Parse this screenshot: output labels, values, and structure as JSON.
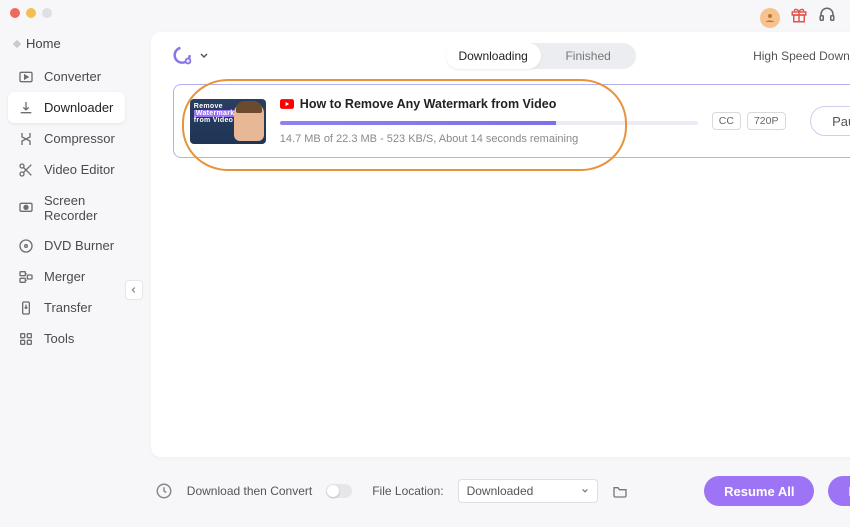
{
  "window": {
    "home": "Home"
  },
  "nav": [
    {
      "label": "Converter"
    },
    {
      "label": "Downloader"
    },
    {
      "label": "Compressor"
    },
    {
      "label": "Video Editor"
    },
    {
      "label": "Screen Recorder"
    },
    {
      "label": "DVD Burner"
    },
    {
      "label": "Merger"
    },
    {
      "label": "Transfer"
    },
    {
      "label": "Tools"
    }
  ],
  "tabs": {
    "downloading": "Downloading",
    "finished": "Finished"
  },
  "highspeed": {
    "label": "High Speed Download"
  },
  "item": {
    "title": "How to Remove Any Watermark from Video",
    "status": "14.7 MB of 22.3 MB - 523 KB/S, About 14 seconds remaining",
    "cc": "CC",
    "res": "720P",
    "pause": "Pause",
    "thumb_line1": "Remove",
    "thumb_line2": "from Video"
  },
  "footer": {
    "convert_label": "Download then Convert",
    "loc_label": "File Location:",
    "loc_value": "Downloaded",
    "resume": "Resume All",
    "pause": "Pause All"
  }
}
